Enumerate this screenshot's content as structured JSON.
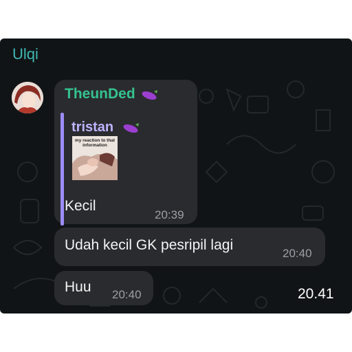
{
  "chat": {
    "name": "Ulqi"
  },
  "messages": [
    {
      "sender": "TheunDed",
      "sender_emoji": "eggplant",
      "reply": {
        "name": "tristan",
        "name_emoji": "eggplant",
        "thumbnail_caption": "my reaction to that information"
      },
      "text": "Kecil",
      "time": "20:39"
    },
    {
      "text": "Udah kecil GK pesripil lagi",
      "time": "20:40"
    },
    {
      "text": "Huu",
      "time": "20:40"
    }
  ],
  "overlay_time": "20.41",
  "colors": {
    "header_name": "#3fb7b2",
    "sender": "#35c38f",
    "reply_accent": "#9b8cf5",
    "bubble": "#2a2b2f",
    "background": "#111416"
  }
}
